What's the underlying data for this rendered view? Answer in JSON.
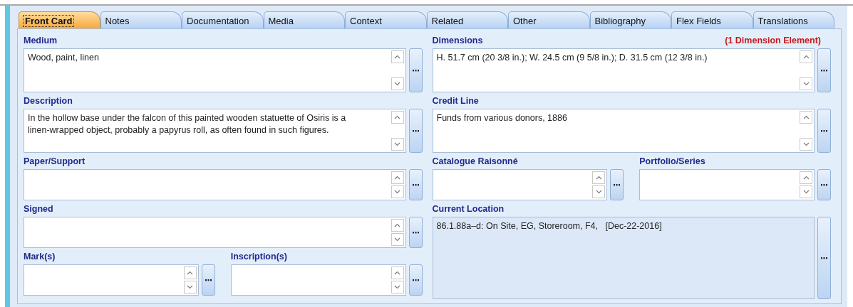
{
  "tabs": [
    {
      "label": "Front Card",
      "selected": true
    },
    {
      "label": "Notes",
      "selected": false
    },
    {
      "label": "Documentation",
      "selected": false
    },
    {
      "label": "Media",
      "selected": false
    },
    {
      "label": "Context",
      "selected": false
    },
    {
      "label": "Related",
      "selected": false
    },
    {
      "label": "Other",
      "selected": false
    },
    {
      "label": "Bibliography",
      "selected": false
    },
    {
      "label": "Flex Fields",
      "selected": false
    },
    {
      "label": "Translations",
      "selected": false
    }
  ],
  "left": [
    {
      "fields": [
        {
          "label": "Medium",
          "kind": "memo",
          "value": "Wood, paint, linen"
        }
      ]
    },
    {
      "fields": [
        {
          "label": "Description",
          "kind": "memo",
          "value": "In the hollow base under the falcon of this painted wooden statuette of Osiris is a linen-wrapped object, probably a papyrus roll, as often found in such figures."
        }
      ]
    },
    {
      "fields": [
        {
          "label": "Paper/Support",
          "kind": "line"
        }
      ]
    },
    {
      "fields": [
        {
          "label": "Signed",
          "kind": "line"
        }
      ]
    },
    {
      "fields": [
        {
          "label": "Mark(s)",
          "kind": "line"
        },
        {
          "label": "Inscription(s)",
          "kind": "line"
        }
      ]
    }
  ],
  "right": [
    {
      "fields": [
        {
          "label": "Dimensions",
          "kind": "memo",
          "note": "(1 Dimension Element)",
          "value": "H. 51.7 cm (20 3/8 in.); W. 24.5 cm (9 5/8 in.); D. 31.5 cm (12 3/8 in.)"
        }
      ]
    },
    {
      "fields": [
        {
          "label": "Credit Line",
          "kind": "memo",
          "value": "Funds from various donors, 1886"
        }
      ]
    },
    {
      "fields": [
        {
          "label": "Catalogue Raisonné",
          "kind": "line"
        },
        {
          "label": "Portfolio/Series",
          "kind": "line"
        }
      ]
    },
    {
      "fields": [
        {
          "label": "Current Location",
          "kind": "location",
          "value": "86.1.88a–d: On Site, EG, Storeroom, F4,   [Dec-22-2016]"
        }
      ]
    }
  ]
}
